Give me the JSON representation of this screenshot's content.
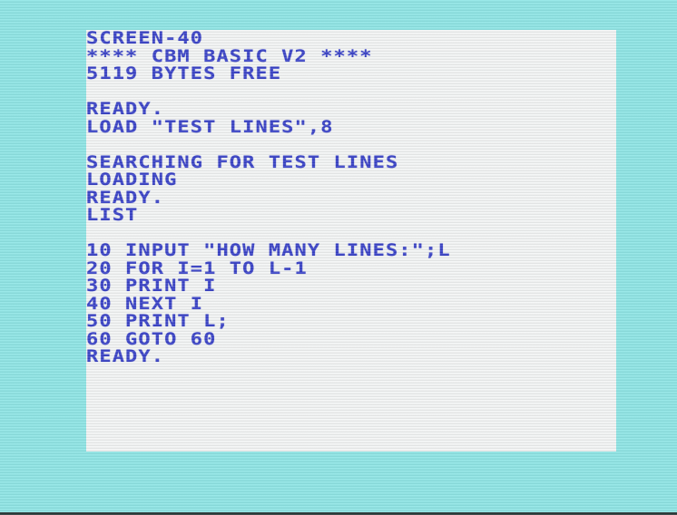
{
  "screen": {
    "border_color": "#8fe6e6",
    "background_color": "#f4f6f6",
    "text_color": "#3a43c8",
    "lines": [
      "SCREEN-40",
      "**** CBM BASIC V2 ****",
      "5119 BYTES FREE",
      "",
      "READY.",
      "LOAD \"TEST LINES\",8",
      "",
      "SEARCHING FOR TEST LINES",
      "LOADING",
      "READY.",
      "LIST",
      "",
      "10 INPUT \"HOW MANY LINES:\";L",
      "20 FOR I=1 TO L-1",
      "30 PRINT I",
      "40 NEXT I",
      "50 PRINT L;",
      "60 GOTO 60",
      "READY."
    ]
  }
}
